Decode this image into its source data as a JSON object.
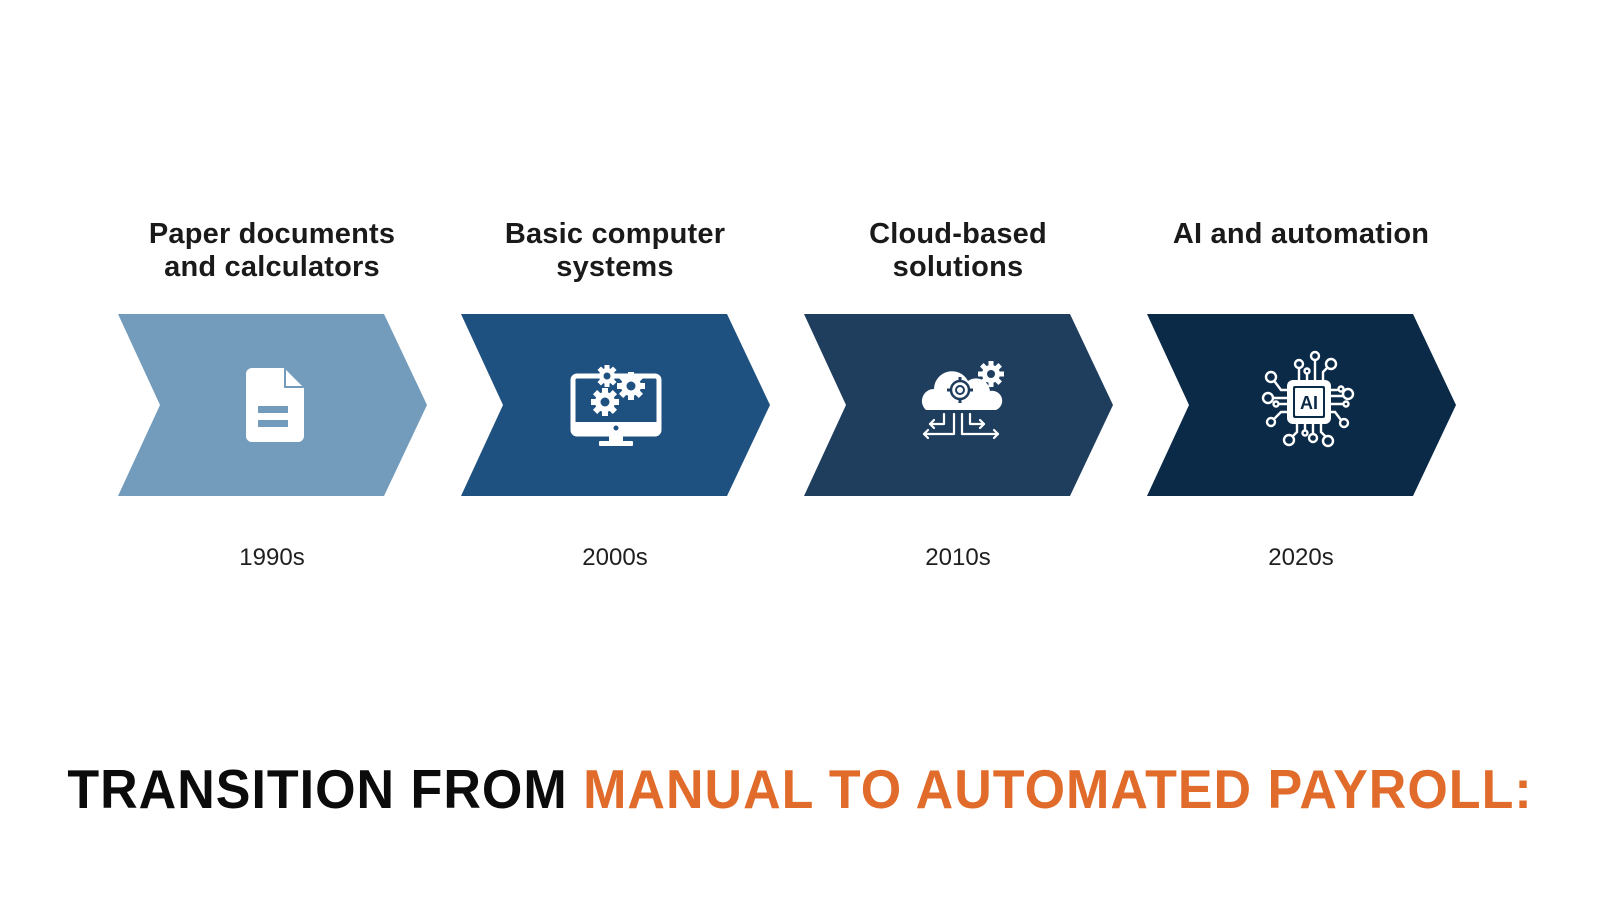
{
  "timeline": {
    "steps": [
      {
        "title_line1": "Paper documents",
        "title_line2": "and calculators",
        "year": "1990s",
        "icon": "document-icon",
        "color": "#739cbc"
      },
      {
        "title_line1": "Basic computer",
        "title_line2": "systems",
        "year": "2000s",
        "icon": "computer-gears-icon",
        "color": "#1f5180"
      },
      {
        "title_line1": "Cloud-based",
        "title_line2": "solutions",
        "year": "2010s",
        "icon": "cloud-gears-icon",
        "color": "#1f3e5e"
      },
      {
        "title_line1": "AI and automation",
        "title_line2": "",
        "year": "2020s",
        "icon": "ai-chip-icon",
        "color": "#0b2a47"
      }
    ]
  },
  "headline": {
    "part1": "TRANSITION FROM ",
    "part2": "MANUAL TO AUTOMATED PAYROLL:",
    "color_dark": "#0b0b0b",
    "color_accent": "#e06b2b"
  }
}
